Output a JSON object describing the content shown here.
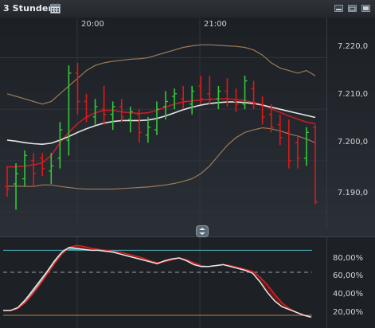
{
  "window": {
    "period_label": "3 Stunden",
    "calendar_icon": "calendar-icon",
    "controls": [
      "minimize-icon",
      "restore-icon",
      "maximize-icon"
    ]
  },
  "chart_data": [
    {
      "type": "candlestick",
      "name_shown": "",
      "x_labels": [
        "20:00",
        "21:00"
      ],
      "y_ticks": [
        "7.220,0",
        "7.210,0",
        "7.200,0",
        "7.190,0"
      ],
      "ylim": [
        7187.0,
        7227.8
      ],
      "grid": true,
      "bars": [
        {
          "o": 7195.0,
          "h": 7199.0,
          "l": 7193.0,
          "c": 7194.5
        },
        {
          "o": 7195.5,
          "h": 7199.5,
          "l": 7190.5,
          "c": 7197.5
        },
        {
          "o": 7196.5,
          "h": 7202.0,
          "l": 7195.0,
          "c": 7201.0
        },
        {
          "o": 7200.0,
          "h": 7201.5,
          "l": 7195.0,
          "c": 7197.5
        },
        {
          "o": 7200.5,
          "h": 7201.5,
          "l": 7197.0,
          "c": 7198.5
        },
        {
          "o": 7198.0,
          "h": 7201.5,
          "l": 7195.5,
          "c": 7199.0
        },
        {
          "o": 7200.5,
          "h": 7207.5,
          "l": 7198.5,
          "c": 7206.0
        },
        {
          "o": 7204.0,
          "h": 7218.5,
          "l": 7201.0,
          "c": 7217.0
        },
        {
          "o": 7217.0,
          "h": 7219.0,
          "l": 7209.0,
          "c": 7211.5
        },
        {
          "o": 7211.5,
          "h": 7213.0,
          "l": 7207.5,
          "c": 7208.5
        },
        {
          "o": 7208.5,
          "h": 7212.0,
          "l": 7207.0,
          "c": 7210.5
        },
        {
          "o": 7210.0,
          "h": 7214.5,
          "l": 7207.0,
          "c": 7209.0
        },
        {
          "o": 7209.0,
          "h": 7211.5,
          "l": 7206.0,
          "c": 7210.5
        },
        {
          "o": 7210.5,
          "h": 7212.0,
          "l": 7207.5,
          "c": 7208.5
        },
        {
          "o": 7208.0,
          "h": 7210.5,
          "l": 7205.5,
          "c": 7209.5
        },
        {
          "o": 7209.0,
          "h": 7210.0,
          "l": 7203.5,
          "c": 7205.5
        },
        {
          "o": 7205.0,
          "h": 7208.5,
          "l": 7203.5,
          "c": 7206.5
        },
        {
          "o": 7206.0,
          "h": 7211.5,
          "l": 7205.0,
          "c": 7210.0
        },
        {
          "o": 7210.5,
          "h": 7213.5,
          "l": 7208.0,
          "c": 7211.5
        },
        {
          "o": 7212.5,
          "h": 7214.0,
          "l": 7210.0,
          "c": 7213.0
        },
        {
          "o": 7212.0,
          "h": 7214.5,
          "l": 7210.0,
          "c": 7211.5
        },
        {
          "o": 7211.0,
          "h": 7214.5,
          "l": 7209.0,
          "c": 7213.5
        },
        {
          "o": 7214.5,
          "h": 7216.5,
          "l": 7211.0,
          "c": 7212.0
        },
        {
          "o": 7213.0,
          "h": 7216.5,
          "l": 7211.0,
          "c": 7212.0
        },
        {
          "o": 7212.0,
          "h": 7214.5,
          "l": 7210.0,
          "c": 7213.5
        },
        {
          "o": 7213.5,
          "h": 7216.0,
          "l": 7210.5,
          "c": 7212.0
        },
        {
          "o": 7211.5,
          "h": 7214.0,
          "l": 7209.5,
          "c": 7211.0
        },
        {
          "o": 7211.0,
          "h": 7216.5,
          "l": 7210.0,
          "c": 7215.5
        },
        {
          "o": 7214.0,
          "h": 7215.5,
          "l": 7210.0,
          "c": 7211.0
        },
        {
          "o": 7211.0,
          "h": 7212.5,
          "l": 7207.0,
          "c": 7208.5
        },
        {
          "o": 7209.0,
          "h": 7211.0,
          "l": 7205.5,
          "c": 7206.5
        },
        {
          "o": 7207.0,
          "h": 7209.0,
          "l": 7203.0,
          "c": 7204.5
        },
        {
          "o": 7205.5,
          "h": 7208.0,
          "l": 7198.5,
          "c": 7200.0
        },
        {
          "o": 7203.5,
          "h": 7205.0,
          "l": 7198.5,
          "c": 7200.5
        },
        {
          "o": 7200.5,
          "h": 7206.5,
          "l": 7199.0,
          "c": 7205.5
        },
        {
          "o": 7206.5,
          "h": 7207.0,
          "l": 7191.5,
          "c": 7192.0
        }
      ],
      "overlays": [
        {
          "color": "#c41e24",
          "values": [
            7198.8,
            7198.8,
            7199.0,
            7199.2,
            7199.6,
            7201.0,
            7203.5,
            7205.5,
            7207.2,
            7208.5,
            7209.3,
            7209.8,
            7209.8,
            7209.5,
            7209.3,
            7209.2,
            7209.3,
            7209.8,
            7210.4,
            7211.0,
            7211.4,
            7211.6,
            7211.8,
            7211.9,
            7212.0,
            7212.0,
            7211.9,
            7211.7,
            7211.3,
            7210.8,
            7210.1,
            7209.4,
            7208.7,
            7208.1,
            7207.5,
            7207.2
          ]
        },
        {
          "color": "#e6e6e6",
          "values": [
            7204.0,
            7203.8,
            7203.5,
            7203.3,
            7203.2,
            7203.4,
            7204.0,
            7204.7,
            7205.5,
            7206.2,
            7206.8,
            7207.3,
            7207.6,
            7207.8,
            7207.8,
            7207.8,
            7207.9,
            7208.2,
            7208.7,
            7209.3,
            7209.9,
            7210.4,
            7210.8,
            7211.1,
            7211.3,
            7211.4,
            7211.4,
            7211.3,
            7211.1,
            7210.8,
            7210.4,
            7210.0,
            7209.6,
            7209.2,
            7208.8,
            7208.4
          ]
        },
        {
          "color": "#9a7a5a",
          "values": [
            7213.0,
            7212.5,
            7212.0,
            7211.5,
            7211.0,
            7211.5,
            7213.0,
            7214.5,
            7216.0,
            7217.5,
            7218.5,
            7219.0,
            7219.3,
            7219.5,
            7219.7,
            7219.8,
            7220.0,
            7220.5,
            7221.0,
            7221.5,
            7222.0,
            7222.3,
            7222.5,
            7222.5,
            7222.4,
            7222.3,
            7222.2,
            7222.0,
            7221.5,
            7220.5,
            7219.0,
            7218.0,
            7217.5,
            7217.0,
            7217.5,
            7216.5
          ]
        },
        {
          "color": "#9a7a5a",
          "values": [
            7195.0,
            7195.1,
            7195.0,
            7195.0,
            7195.3,
            7195.3,
            7195.0,
            7194.8,
            7194.6,
            7194.5,
            7194.5,
            7194.5,
            7194.5,
            7194.6,
            7194.7,
            7194.8,
            7194.9,
            7195.1,
            7195.3,
            7195.6,
            7196.0,
            7196.5,
            7197.5,
            7199.0,
            7201.0,
            7203.0,
            7204.5,
            7205.5,
            7206.0,
            7206.4,
            7206.2,
            7205.8,
            7205.2,
            7204.8,
            7204.2,
            7203.5
          ]
        }
      ]
    },
    {
      "type": "line",
      "y_ticks": [
        "80,00%",
        "60,00%",
        "40,00%",
        "20,00%"
      ],
      "ylim": [
        10,
        100
      ],
      "levels": [
        {
          "value": 88,
          "color": "#46b4c0",
          "style": "solid"
        },
        {
          "value": 65,
          "color": "#9aa0a6",
          "style": "dashed"
        },
        {
          "value": 20,
          "color": "#c07a40",
          "style": "solid"
        }
      ],
      "series": [
        {
          "color": "#e02020",
          "values": [
            25,
            25,
            27,
            33,
            42,
            52,
            63,
            74,
            84,
            91,
            93,
            92,
            90,
            89,
            88,
            87,
            86,
            84,
            82,
            80,
            77,
            75,
            76,
            78,
            80,
            78,
            75,
            72,
            71,
            72,
            73,
            72,
            70,
            68,
            66,
            60,
            52,
            42,
            33,
            27,
            23,
            20,
            18
          ]
        },
        {
          "color": "#e8e8e8",
          "values": [
            25,
            25,
            28,
            36,
            46,
            56,
            66,
            77,
            86,
            91,
            90,
            89,
            88,
            88,
            87,
            86,
            84,
            82,
            80,
            78,
            76,
            74,
            77,
            79,
            80,
            77,
            73,
            71,
            71,
            72,
            73,
            71,
            69,
            67,
            64,
            55,
            44,
            35,
            29,
            26,
            23,
            20,
            18
          ]
        }
      ]
    }
  ]
}
